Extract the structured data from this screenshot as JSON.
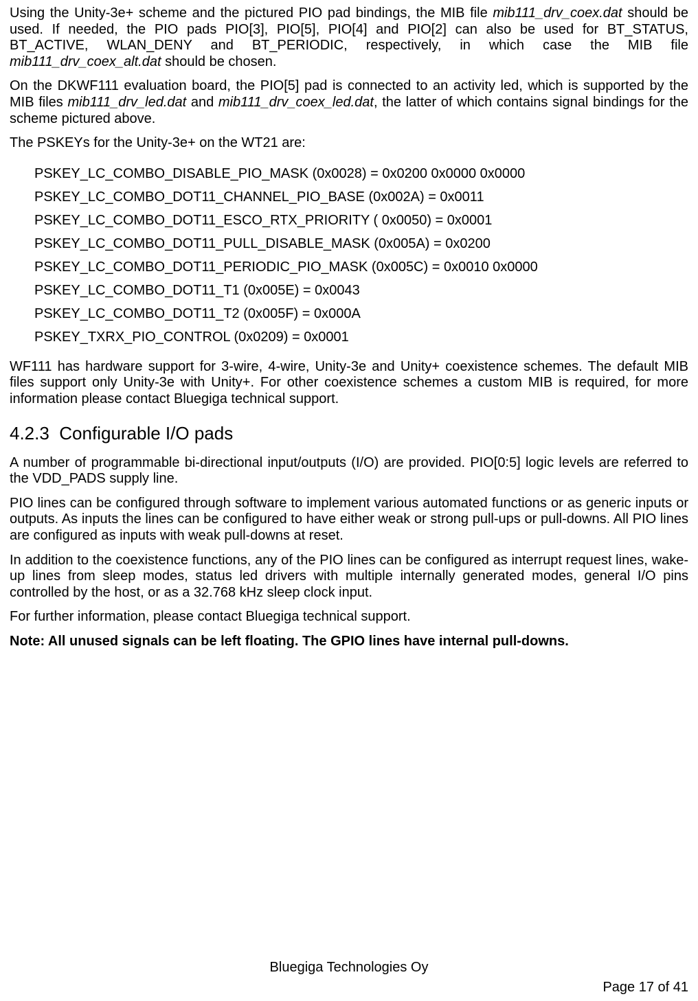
{
  "paragraphs": {
    "p1a": "Using the Unity-3e+ scheme and the pictured PIO pad bindings, the MIB file ",
    "p1_file1": "mib111_drv_coex.dat",
    "p1b": " should be used. If needed, the PIO pads PIO[3], PIO[5], PIO[4] and PIO[2] can also be used for BT_STATUS, BT_ACTIVE, WLAN_DENY and BT_PERIODIC, respectively, in which case the MIB file ",
    "p1_file2": "mib111_drv_coex_alt.dat",
    "p1c": " should be chosen.",
    "p2a": "On the DKWF111 evaluation board, the PIO[5] pad is connected to an activity led, which is supported by the MIB files ",
    "p2_file1": "mib111_drv_led.dat",
    "p2_and": " and ",
    "p2_file2": "mib111_drv_coex_led.dat",
    "p2b": ", the latter of which contains signal bindings for the scheme pictured above.",
    "p3": "The PSKEYs for the Unity-3e+ on the WT21 are:",
    "p4": "WF111 has hardware support for 3-wire, 4-wire, Unity-3e and Unity+ coexistence schemes. The default MIB files support only Unity-3e with Unity+. For other coexistence schemes a custom MIB is required, for more information please contact Bluegiga technical support.",
    "p5": "A number of programmable bi-directional input/outputs (I/O) are provided. PIO[0:5] logic levels are referred to the VDD_PADS supply line.",
    "p6": "PIO lines can be configured through software to implement various automated functions or as generic inputs or outputs. As inputs the lines can be configured to have either weak or strong pull-ups or pull-downs. All PIO lines are configured as inputs with weak pull-downs at reset.",
    "p7": "In addition to the coexistence functions, any of the PIO lines can be configured as interrupt request lines, wake-up lines from sleep modes, status led drivers with multiple internally generated modes, general I/O pins controlled by the host, or as a 32.768 kHz sleep clock input.",
    "p8": "For further information, please contact Bluegiga technical support.",
    "p9": "Note: All unused signals can be left floating. The GPIO lines have internal pull-downs."
  },
  "pskeys": [
    "PSKEY_LC_COMBO_DISABLE_PIO_MASK (0x0028) = 0x0200 0x0000 0x0000",
    "PSKEY_LC_COMBO_DOT11_CHANNEL_PIO_BASE (0x002A) = 0x0011",
    "PSKEY_LC_COMBO_DOT11_ESCO_RTX_PRIORITY ( 0x0050) = 0x0001",
    "PSKEY_LC_COMBO_DOT11_PULL_DISABLE_MASK (0x005A) = 0x0200",
    "PSKEY_LC_COMBO_DOT11_PERIODIC_PIO_MASK (0x005C) = 0x0010 0x0000",
    "PSKEY_LC_COMBO_DOT11_T1 (0x005E) = 0x0043",
    "PSKEY_LC_COMBO_DOT11_T2 (0x005F) = 0x000A",
    "PSKEY_TXRX_PIO_CONTROL (0x0209) = 0x0001"
  ],
  "heading": {
    "number": "4.2.3",
    "title": "Configurable I/O pads"
  },
  "footer": {
    "company": "Bluegiga Technologies Oy",
    "page": "Page 17 of 41"
  }
}
